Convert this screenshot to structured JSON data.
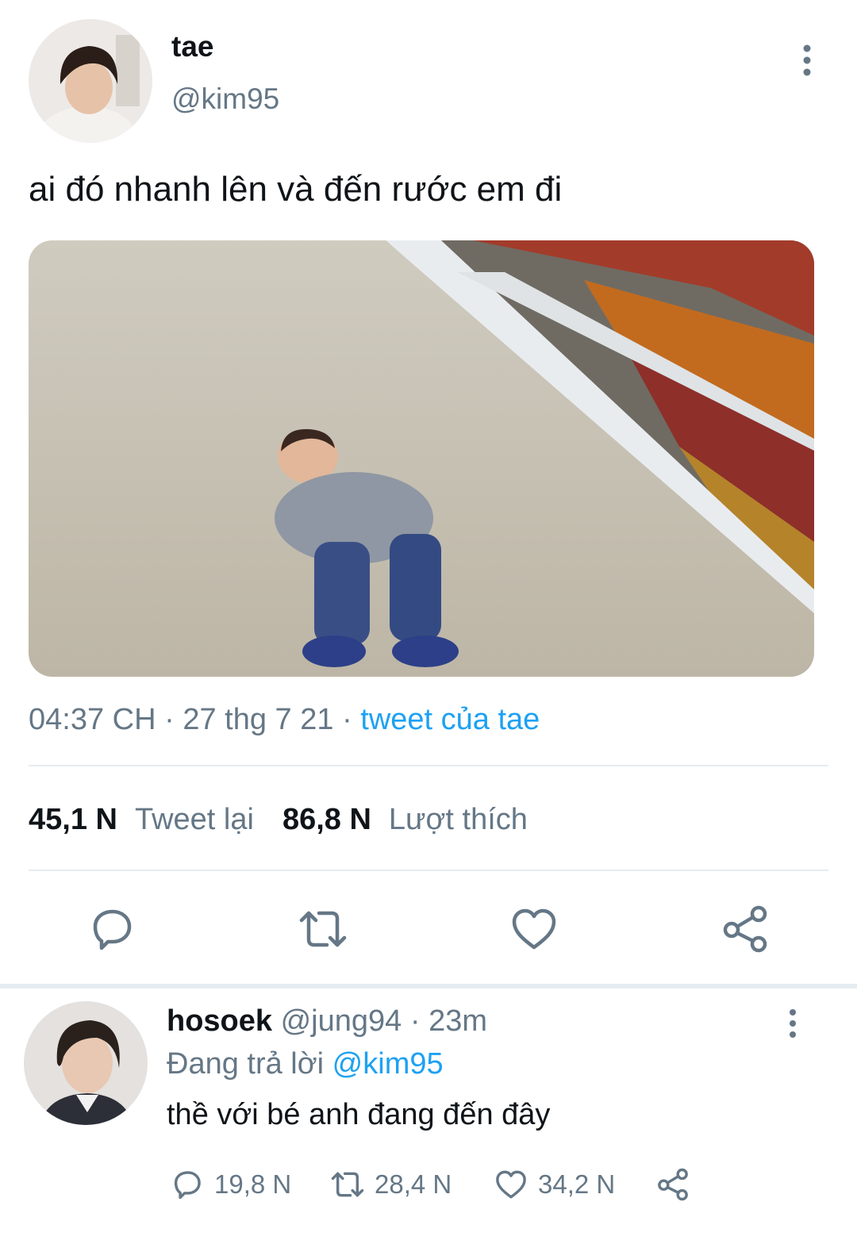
{
  "tweet": {
    "display_name": "tae",
    "handle": "@kim95",
    "text": "ai đó nhanh lên và đến rước em đi",
    "time": "04:37 CH",
    "date": "27 thg 7 21",
    "source": "tweet của tae",
    "retweet_count": "45,1 N",
    "retweet_label": "Tweet lại",
    "like_count": "86,8 N",
    "like_label": "Lượt thích"
  },
  "reply": {
    "display_name": "hosoek",
    "handle": "@jung94",
    "age": "23m",
    "replying_to_label": "Đang trả lời",
    "replying_to_handle": "@kim95",
    "text": "thề với bé anh đang đến đây",
    "reply_count": "19,8 N",
    "retweet_count": "28,4 N",
    "like_count": "34,2 N"
  },
  "icons": {
    "more": "more-vertical-icon",
    "reply": "reply-icon",
    "retweet": "retweet-icon",
    "like": "heart-icon",
    "share": "share-icon"
  },
  "colors": {
    "accent": "#1da1f2",
    "muted": "#657786",
    "divider": "#e6ecf0"
  }
}
